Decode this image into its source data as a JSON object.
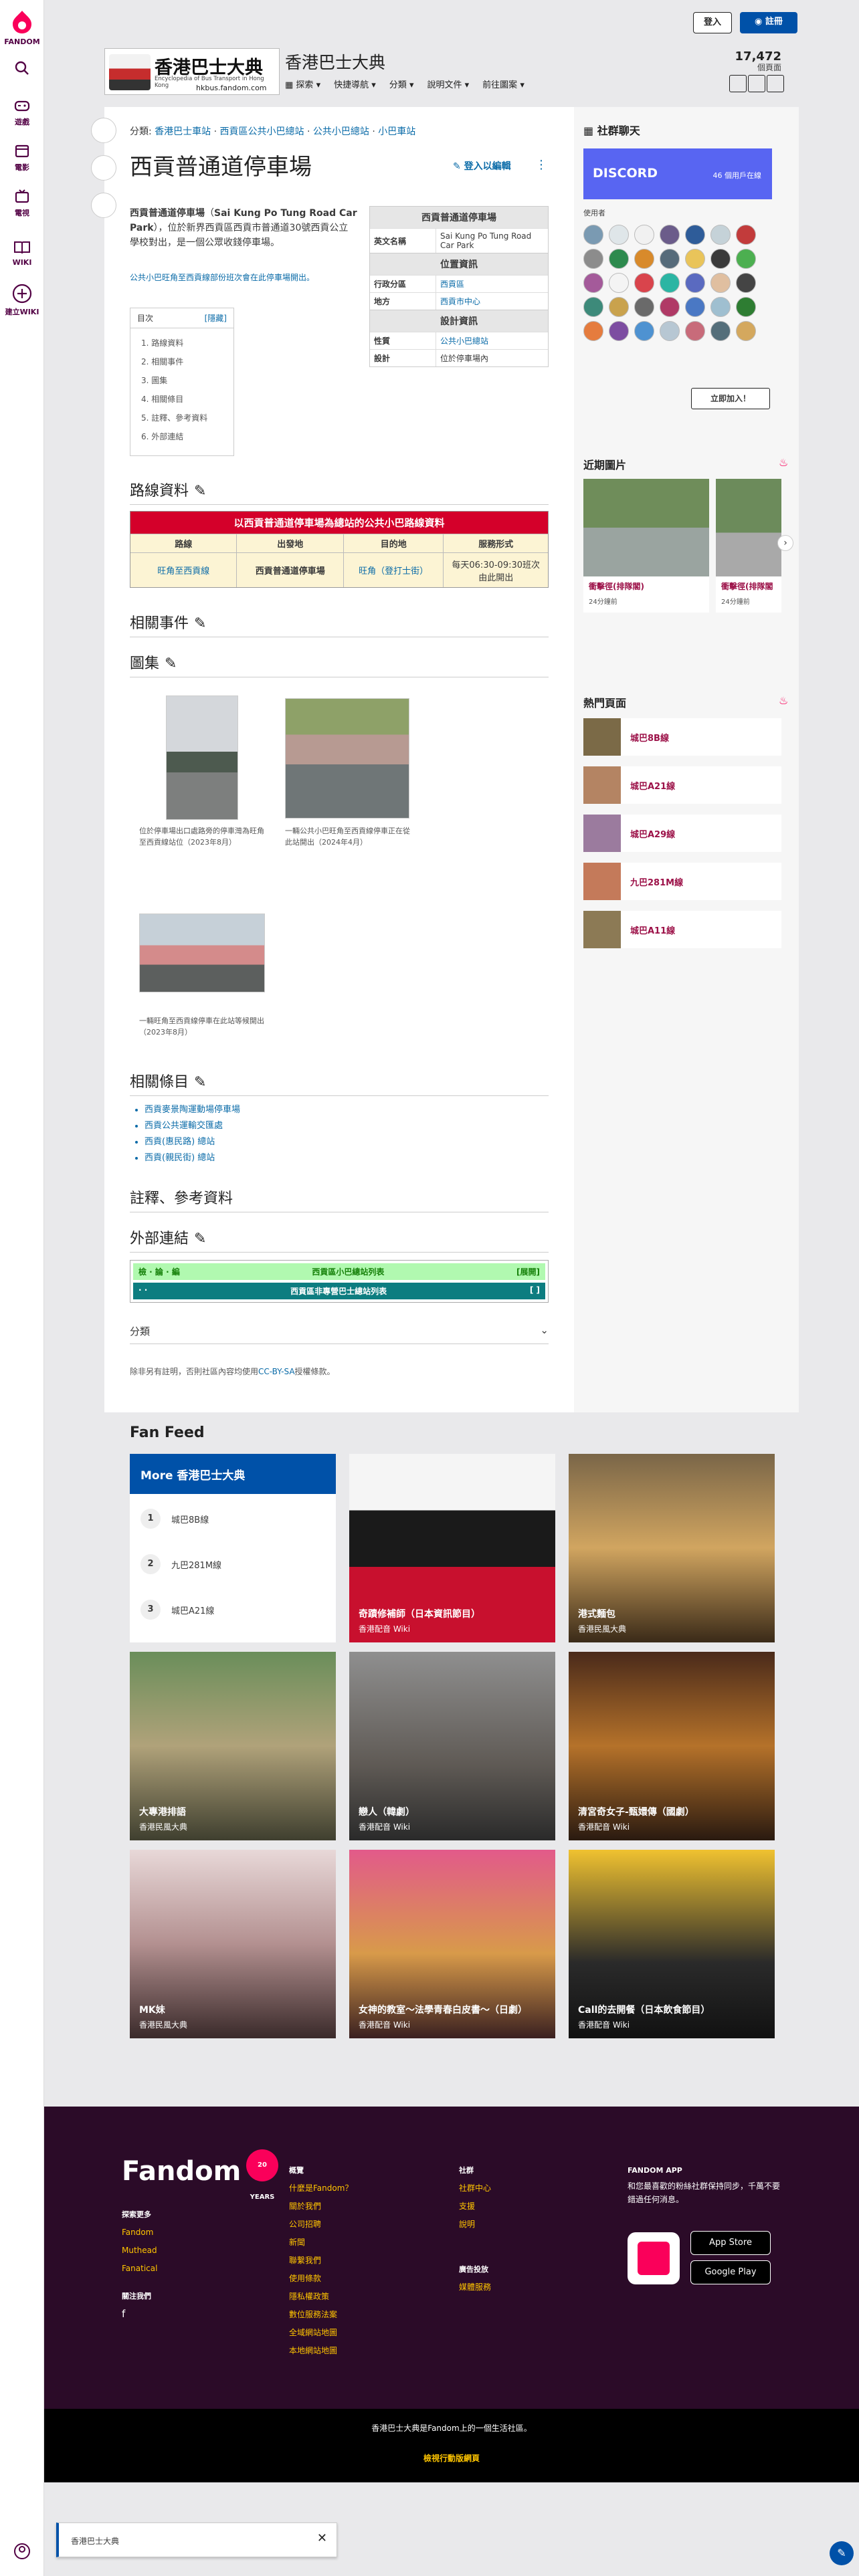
{
  "rail": {
    "fandom_label": "FANDOM",
    "items": [
      {
        "label": "遊戲"
      },
      {
        "label": "電影"
      },
      {
        "label": "電視"
      },
      {
        "label": "WIKI"
      }
    ],
    "create_wiki": "建立WIKI"
  },
  "top": {
    "login": "登入",
    "register": "註冊"
  },
  "wiki": {
    "logo_title": "香港巴士大典",
    "logo_sub": "Encyclopedia of Bus Transport in Hong Kong",
    "logo_url": "hkbus.fandom.com",
    "title": "香港巴士大典",
    "nav": [
      "探索",
      "快捷導航",
      "分類",
      "說明文件",
      "前往圖案"
    ],
    "pages_count": "17,472",
    "pages_label": "個頁面"
  },
  "page": {
    "breadcrumb_prefix": "分類: ",
    "breadcrumb": [
      "香港巴士車站",
      "西貢區公共小巴總站",
      "公共小巴總站",
      "小巴車站"
    ],
    "title": "西貢普通道停車場",
    "edit": "登入以編輯",
    "intro_bold": "西貢普通道停車場",
    "intro_en": "Sai Kung Po Tung Road Car Park",
    "intro_rest": "，位於新界西貢區西貢市普通道30號西貢公立學校對出，是一個公眾收錢停車場。",
    "intro2": "公共小巴旺角至西貢線部份班次會在此停車場開出。",
    "toc": {
      "title": "目次",
      "toggle": "[隱藏]",
      "items": [
        "1. 路線資料",
        "2. 相關事件",
        "3. 圖集",
        "4. 相關條目",
        "5. 註釋、參考資料",
        "6. 外部連結"
      ]
    },
    "infobox": {
      "title": "西貢普通道停車場",
      "en_k": "英文名稱",
      "en_v": "Sai Kung Po Tung Road Car Park",
      "loc_title": "位置資訊",
      "district_k": "行政分區",
      "district_v": "西貢區",
      "area_k": "地方",
      "area_v": "西貢市中心",
      "design_title": "設計資訊",
      "nature_k": "性質",
      "nature_v": "公共小巴總站",
      "design_k": "設計",
      "design_v": "位於停車場內"
    },
    "sections": {
      "routes": "路線資料",
      "events": "相關事件",
      "gallery": "圖集",
      "related": "相關條目",
      "notes": "註釋、參考資料",
      "links": "外部連結"
    },
    "route_table": {
      "title": "以西貢普通道停車場為總站的公共小巴路線資料",
      "headers": [
        "路線",
        "出發地",
        "目的地",
        "服務形式"
      ],
      "row": {
        "route": "旺角至西貢線",
        "from": "西貢普通道停車場",
        "to": "旺角（登打士街）",
        "service": "每天06:30-09:30班次由此開出"
      }
    },
    "captions": [
      "位於停車場出口處路旁的停車灣為旺角至西貢線站位（2023年8月）",
      "一輛公共小巴旺角至西貢線停車正在從此站開出（2024年4月）",
      "一輛旺角至西貢線停車在此站等候開出（2023年8月）"
    ],
    "related_items": [
      "西貢麥景陶運動場停車場",
      "西貢公共運輸交匯處",
      "西貢(惠民路) 總站",
      "西貢(親民街) 總站"
    ],
    "navbox": {
      "vde": "檢 · 論 · 編",
      "nav1_title": "西貢區小巴總站列表",
      "toggle": "[展開]",
      "dots": "·   ·",
      "nav2_title": "西貢區非專營巴士總站列表",
      "brackets": "[      ]"
    },
    "categories": "分類",
    "license_pre": "除非另有註明，否則社區內容均使用",
    "license_link": "CC-BY-SA",
    "license_post": "授權條款。"
  },
  "right": {
    "social_title": "社群聊天",
    "discord_label": "DISCORD",
    "discord_online": "46 個用戶在線",
    "users_label": "使用者",
    "join": "立即加入！",
    "recent_title": "近期圖片",
    "recent": [
      {
        "title": "衝擊徑(排隊閣)",
        "time": "24分鐘前"
      },
      {
        "title": "衝擊徑(排隊閣",
        "time": "24分鐘前"
      }
    ],
    "hot_title": "熱門頁面",
    "hot": [
      "城巴8B線",
      "城巴A21線",
      "城巴A29線",
      "九巴281M線",
      "城巴A11線"
    ]
  },
  "fanfeed": {
    "title": "Fan Feed",
    "more_title": "More 香港巴士大典",
    "more_items": [
      {
        "n": "1",
        "t": "城巴8B線"
      },
      {
        "n": "2",
        "t": "九巴281M線"
      },
      {
        "n": "3",
        "t": "城巴A21線"
      }
    ],
    "tiles": [
      {
        "t": "奇蹟修補師（日本資訊節目）",
        "s": "香港配音 Wiki"
      },
      {
        "t": "港式麵包",
        "s": "香港民風大典"
      },
      {
        "t": "大專港排語",
        "s": "香港民風大典"
      },
      {
        "t": "戀人（韓劇）",
        "s": "香港配音 Wiki"
      },
      {
        "t": "清宮奇女子-甄嬛傳（國劇）",
        "s": "香港配音 Wiki"
      },
      {
        "t": "MK妹",
        "s": "香港民風大典"
      },
      {
        "t": "女神的教室～法學青春白皮書～（日劇）",
        "s": "香港配音 Wiki"
      },
      {
        "t": "Call的去開餐（日本飲食節目）",
        "s": "香港配音 Wiki"
      }
    ]
  },
  "footer": {
    "logo": "Fandom",
    "years": "20 YEARS",
    "explore_hd": "探索更多",
    "explore": [
      "Fandom",
      "Muthead",
      "Fanatical"
    ],
    "follow_hd": "關注我們",
    "overview_hd": "概覽",
    "overview": [
      "什麼是Fandom？",
      "關於我們",
      "公司招聘",
      "新聞",
      "聯繫我們",
      "使用條款",
      "隱私權政策",
      "數位服務法案",
      "全域網站地圖",
      "本地網站地圖"
    ],
    "community_hd": "社群",
    "community": [
      "社群中心",
      "支援",
      "說明"
    ],
    "ads_hd": "廣告投放",
    "ads": [
      "媒體服務"
    ],
    "app_hd": "FANDOM APP",
    "app_text": "和您最喜歡的粉絲社群保持同步，千萬不要錯過任何消息。",
    "appstore": "App Store",
    "googleplay": "Google Play",
    "bottom_text": "香港巴士大典是Fandom上的一個生活社區。",
    "mobile_link": "檢視行動版網頁"
  },
  "toast": {
    "text": "香港巴士大典"
  }
}
